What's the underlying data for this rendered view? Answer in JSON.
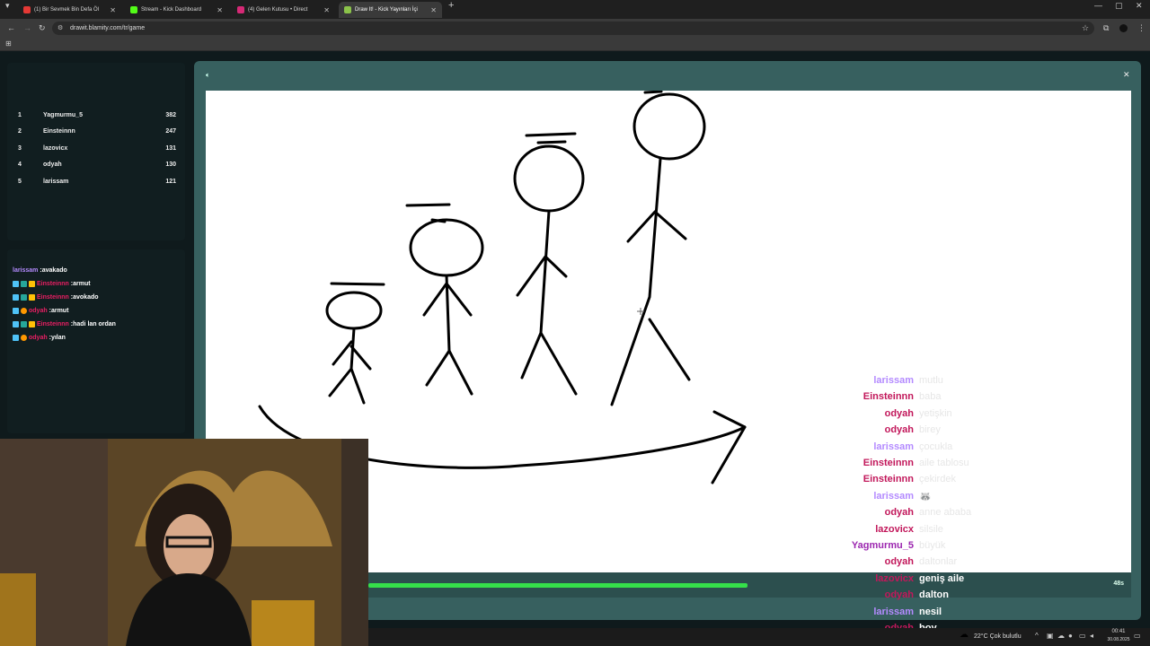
{
  "browser": {
    "tabs": [
      {
        "title": "(1) Bir Sevmek Bin Defa Öl",
        "color": "#e53935"
      },
      {
        "title": "Stream - Kick Dashboard",
        "color": "#53fc18"
      },
      {
        "title": "(4) Gelen Kutusu • Direct",
        "color": "#d62976"
      },
      {
        "title": "Draw It! - Kick Yayınları İçi",
        "color": "#8bc34a"
      }
    ],
    "url": "drawit.blamity.com/tr/game"
  },
  "leaderboard": [
    {
      "rank": "1",
      "name": "Yagmurmu_5",
      "score": "382"
    },
    {
      "rank": "2",
      "name": "Einsteinnn",
      "score": "247"
    },
    {
      "rank": "3",
      "name": "lazovicx",
      "score": "131"
    },
    {
      "rank": "4",
      "name": "odyah",
      "score": "130"
    },
    {
      "rank": "5",
      "name": "larissam",
      "score": "121"
    }
  ],
  "chat": [
    {
      "user": "larissam",
      "text": ":avakado",
      "color": "#b48bff",
      "badges": false
    },
    {
      "user": "Einsteinnn",
      "text": ":armut",
      "color": "#e91e63",
      "badges": true
    },
    {
      "user": "Einsteinnn",
      "text": ":avokado",
      "color": "#e91e63",
      "badges": true
    },
    {
      "user": "odyah",
      "text": ":armut",
      "color": "#e91e63",
      "badges": true
    },
    {
      "user": "Einsteinnn",
      "text": ":hadi lan ordan",
      "color": "#e91e63",
      "badges": true
    },
    {
      "user": "odyah",
      "text": ":yılan",
      "color": "#e91e63",
      "badges": true
    }
  ],
  "guesses": [
    {
      "user": "larissam",
      "word": "mutlu",
      "color": "#b48bff"
    },
    {
      "user": "Einsteinnn",
      "word": "baba",
      "color": "#c2185b"
    },
    {
      "user": "odyah",
      "word": "yetişkin",
      "color": "#c2185b"
    },
    {
      "user": "odyah",
      "word": "birey",
      "color": "#c2185b"
    },
    {
      "user": "larissam",
      "word": "çocukla",
      "color": "#b48bff"
    },
    {
      "user": "Einsteinnn",
      "word": "aile tablosu",
      "color": "#c2185b"
    },
    {
      "user": "Einsteinnn",
      "word": "çekirdek",
      "color": "#c2185b"
    },
    {
      "user": "larissam",
      "word": "🦝",
      "color": "#b48bff"
    },
    {
      "user": "odyah",
      "word": "anne ababa",
      "color": "#c2185b"
    },
    {
      "user": "lazovicx",
      "word": "silsile",
      "color": "#c2185b"
    },
    {
      "user": "Yagmurmu_5",
      "word": "büyük",
      "color": "#9c27b0"
    },
    {
      "user": "odyah",
      "word": "daltonlar",
      "color": "#c2185b"
    },
    {
      "user": "lazovicx",
      "word": "geniş aile",
      "color": "#c2185b"
    },
    {
      "user": "odyah",
      "word": "dalton",
      "color": "#c2185b"
    },
    {
      "user": "larissam",
      "word": "nesil",
      "color": "#b48bff"
    },
    {
      "user": "odyah",
      "word": "boy",
      "color": "#c2185b"
    }
  ],
  "timer": "48s",
  "progress_fraction": 0.41,
  "taskbar": {
    "weather": "22°C  Çok bulutlu",
    "time": "00:41",
    "date": "30.08.2025"
  }
}
